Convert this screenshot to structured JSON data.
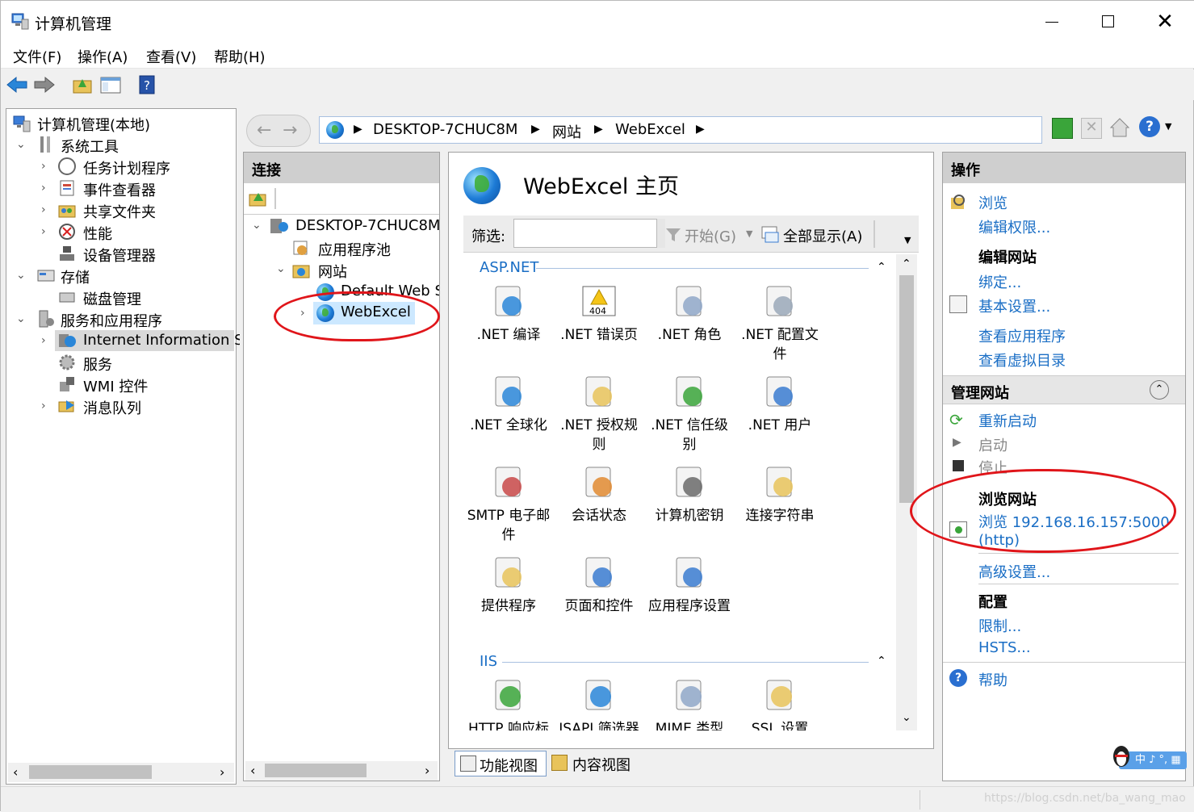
{
  "window": {
    "title": "计算机管理"
  },
  "menu": [
    "文件(F)",
    "操作(A)",
    "查看(V)",
    "帮助(H)"
  ],
  "left_tree": {
    "root": "计算机管理(本地)",
    "items": [
      "系统工具",
      "任务计划程序",
      "事件查看器",
      "共享文件夹",
      "性能",
      "设备管理器",
      "存储",
      "磁盘管理",
      "服务和应用程序",
      "Internet Information Se",
      "服务",
      "WMI 控件",
      "消息队列"
    ]
  },
  "iis": {
    "address": {
      "segments": [
        "DESKTOP-7CHUC8M",
        "网站",
        "WebExcel"
      ]
    },
    "connections": {
      "title": "连接",
      "items": [
        "DESKTOP-7CHUC8M",
        "应用程序池",
        "网站",
        "Default Web S",
        "WebExcel"
      ]
    },
    "main": {
      "title": "WebExcel 主页",
      "filter_label": "筛选:",
      "filter_value": "",
      "start_label": "开始(G)",
      "show_all_label": "全部显示(A)",
      "group1": "ASP.NET",
      "group2": "IIS",
      "features": [
        ".NET 编译",
        ".NET 错误页",
        ".NET 角色",
        ".NET 配置文件",
        ".NET 全球化",
        ".NET 授权规则",
        ".NET 信任级别",
        ".NET 用户",
        "SMTP 电子邮件",
        "会话状态",
        "计算机密钥",
        "连接字符串",
        "提供程序",
        "页面和控件",
        "应用程序设置"
      ],
      "iis_features": [
        "HTTP 响应标",
        "ISAPI 筛选器",
        "MIME 类型",
        "SSL 设置"
      ],
      "icon_404": "404"
    },
    "tabs": [
      "功能视图",
      "内容视图"
    ],
    "actions": {
      "title": "操作",
      "browse": "浏览",
      "edit_perms": "编辑权限...",
      "edit_site": "编辑网站",
      "bindings": "绑定...",
      "basic_settings": "基本设置...",
      "view_apps": "查看应用程序",
      "view_vdirs": "查看虚拟目录",
      "manage_site": "管理网站",
      "restart": "重新启动",
      "start": "启动",
      "stop": "停止",
      "browse_site": "浏览网站",
      "browse_url": "浏览 192.168.16.157:5000",
      "browse_http": "(http)",
      "advanced": "高级设置...",
      "config": "配置",
      "limits": "限制...",
      "hsts": "HSTS...",
      "help": "帮助"
    }
  },
  "ime": "中 ♪ °, ▦",
  "watermark": "https://blog.csdn.net/ba_wang_mao"
}
